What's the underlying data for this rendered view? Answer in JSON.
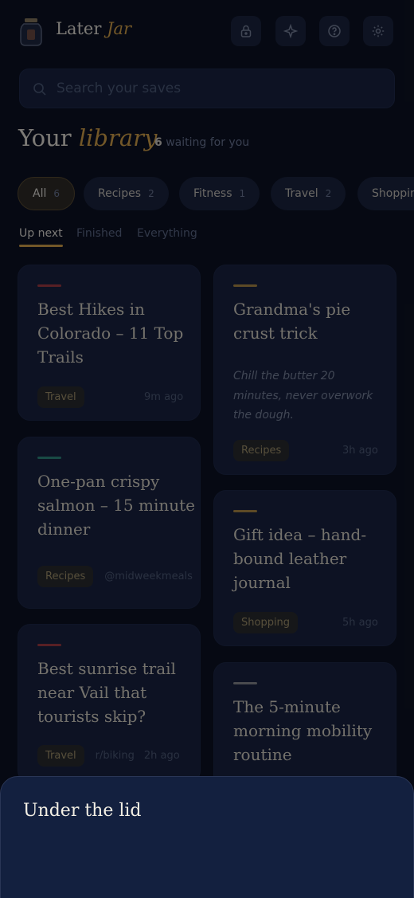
{
  "app": {
    "brand_main": "Later",
    "brand_accent": "Jar",
    "header_icons": [
      "lock-icon",
      "sparkle-icon",
      "help-icon",
      "gear-icon"
    ]
  },
  "search": {
    "placeholder": "Search your saves",
    "value": ""
  },
  "library": {
    "title_main": "Your",
    "title_accent": "library",
    "waiting_count": "6",
    "waiting_text": "waiting for you"
  },
  "chips": [
    {
      "label": "All",
      "count": "6"
    },
    {
      "label": "Recipes",
      "count": "2"
    },
    {
      "label": "Fitness",
      "count": "1"
    },
    {
      "label": "Travel",
      "count": "2"
    },
    {
      "label": "Shopping",
      "count": ""
    }
  ],
  "tabs": [
    "Up next",
    "Finished",
    "Everything"
  ],
  "cards": [
    {
      "title": "Best Hikes in Colorado – 11 Top Trails",
      "note": "",
      "tag": "Travel",
      "source": "",
      "time": "9m ago",
      "accent": "#a5393a"
    },
    {
      "title": "Grandma's pie crust trick",
      "note": "Chill the butter 20 minutes, never overwork the dough.",
      "tag": "Recipes",
      "source": "",
      "time": "3h ago",
      "accent": "#b08a3e"
    },
    {
      "title": "One-pan crispy salmon – 15 minute dinner",
      "note": "",
      "tag": "Recipes",
      "source": "@midweekmeals",
      "time": "",
      "accent": "#2f8a7a"
    },
    {
      "title": "Gift idea – hand-bound leather journal",
      "note": "",
      "tag": "Shopping",
      "source": "",
      "time": "5h ago",
      "accent": "#b08a3e"
    },
    {
      "title": "Best sunrise trail near Vail that tourists skip?",
      "note": "",
      "tag": "Travel",
      "source": "r/biking",
      "time": "2h ago",
      "accent": "#a5393a"
    },
    {
      "title": "The 5-minute morning mobility routine",
      "note": "",
      "tag": "",
      "source": "",
      "time": "",
      "accent": "#8a8a8a"
    }
  ],
  "sheet": {
    "title": "Under the lid"
  },
  "colors": {
    "background": "#0b0f1a",
    "card": "#172038",
    "accent": "#d9a441",
    "sheet": "#13203f"
  }
}
